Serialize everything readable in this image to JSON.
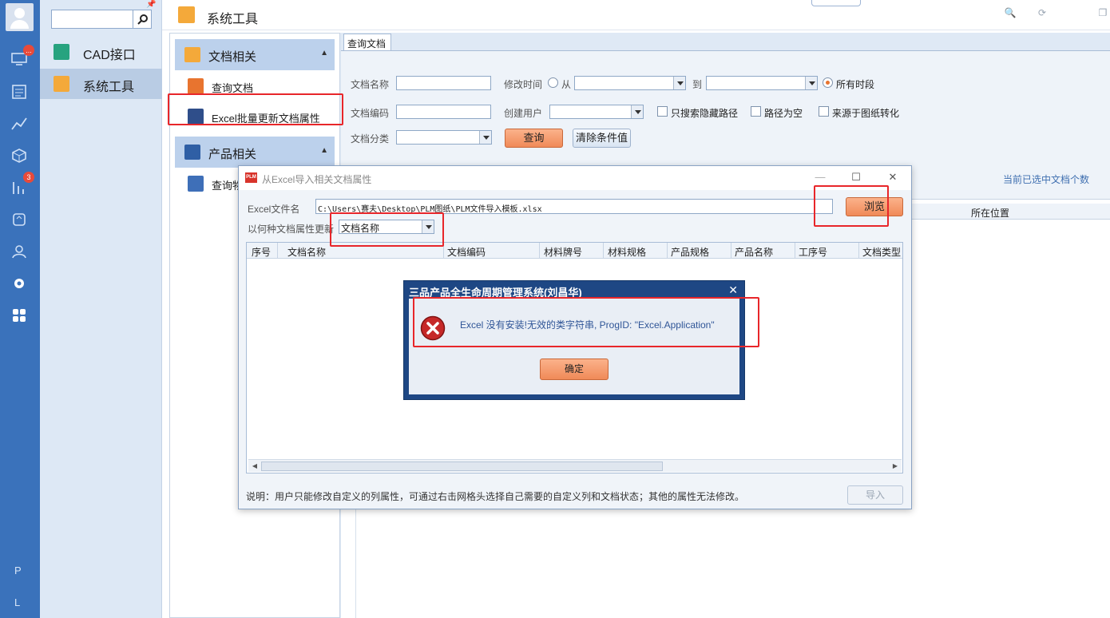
{
  "rail": {
    "badges": {
      "monitor": "...",
      "chart": "3"
    },
    "letters": [
      "P",
      "L"
    ]
  },
  "modules": {
    "items": [
      {
        "label": "CAD接口",
        "icon": "cad-icon"
      },
      {
        "label": "系统工具",
        "icon": "tools-icon"
      }
    ]
  },
  "header": {
    "title": "系统工具"
  },
  "nav": {
    "groups": [
      {
        "label": "文档相关",
        "items": [
          {
            "label": "查询文档"
          },
          {
            "label": "Excel批量更新文档属性"
          }
        ]
      },
      {
        "label": "产品相关",
        "items": [
          {
            "label": "查询物"
          }
        ]
      }
    ]
  },
  "query": {
    "tab": "查询文档",
    "doc_name": "文档名称",
    "modify_time": "修改时间",
    "from": "从",
    "to": "到",
    "all_periods": "所有时段",
    "doc_code": "文档编码",
    "creator": "创建用户",
    "search_hidden_path": "只搜索隐藏路径",
    "empty_path": "路径为空",
    "from_drawing": "来源于图纸转化",
    "doc_category": "文档分类",
    "query_button": "查询",
    "clear_button": "清除条件值",
    "selected_count": "当前已选中文档个数",
    "grid_location": "所在位置"
  },
  "dialog": {
    "logo": "PLM",
    "title": "从Excel导入相关文档属性",
    "excel_label": "Excel文件名",
    "excel_path": "C:\\Users\\赛夫\\Desktop\\PLM图纸\\PLM文件导入模板.xlsx",
    "browse_button": "浏览",
    "update_label": "以何种文档属性更新",
    "update_value": "文档名称",
    "columns": [
      "序号",
      "文档名称",
      "文档编码",
      "材料牌号",
      "材料规格",
      "产品规格",
      "产品名称",
      "工序号",
      "文档类型"
    ],
    "note": "说明：用户只能修改自定义的列属性，可通过右击网格头选择自己需要的自定义列和文档状态；其他的属性无法修改。",
    "import_button": "导入"
  },
  "error_box": {
    "title": "三品产品全生命周期管理系统(刘昌华)",
    "message": "Excel 没有安装!无效的类字符串, ProgID: \"Excel.Application\"",
    "ok_button": "确定"
  }
}
